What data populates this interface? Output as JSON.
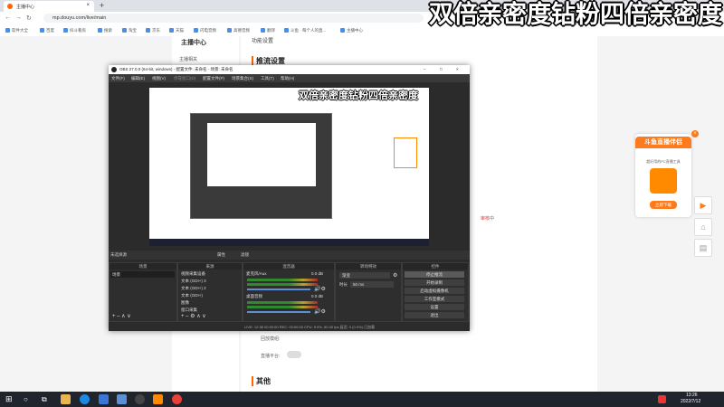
{
  "overlay_banner": "双倍亲密度钻粉四倍亲密度",
  "browser": {
    "tab_title": "主播中心",
    "new_tab": "+",
    "url": "mp.douyu.com/live/main",
    "bookmarks": [
      "软件大全",
      "百度",
      "抖斗看房",
      "搜索",
      "淘宝",
      "京东",
      "天猫",
      "闪电音频",
      "高德音频",
      "翻译",
      "斗鱼 · 每个人的直...",
      "主播中心"
    ]
  },
  "page": {
    "leftnav_title": "主播中心",
    "leftnav_item": "主播相关",
    "content_top": "功能设置",
    "section_push": "推流设置",
    "section_other": "其他",
    "label_record": "回放模组:",
    "label_fans": "直播平台:",
    "side_text": "审核中"
  },
  "promo": {
    "title": "斗鱼直播伴侣",
    "desc": "超好用的PC直播工具",
    "button": "立即下载",
    "close": "×"
  },
  "obs": {
    "title": "OBS 27.0.0 (64-bit, windows) - 配置文件: 未命名 - 场景: 未命名",
    "menu": [
      "文件(F)",
      "编辑(E)",
      "视图(V)",
      "停靠窗口(D)",
      "配置文件(P)",
      "场景集合(S)",
      "工具(T)",
      "帮助(H)"
    ],
    "preview_banner": "双倍亲密度钻粉四倍亲密度",
    "no_source": "未选择源",
    "props_button": "属性",
    "filters_button": "滤镜",
    "docks": {
      "scenes": {
        "title": "场景",
        "items": [
          "场景"
        ]
      },
      "sources": {
        "title": "来源",
        "items": [
          "视频采集设备",
          "文本 (GDI+) 3",
          "文本 (GDI+) 2",
          "文本 (GDI+)",
          "图像",
          "窗口采集"
        ]
      },
      "mixer": {
        "title": "混音器",
        "items": [
          "麦克风/Aux",
          "0.0 dB",
          "桌面音频",
          "0.0 dB"
        ]
      },
      "transitions": {
        "title": "转场特效",
        "items": [
          "渐变",
          "时长",
          "50 ms"
        ]
      },
      "controls": {
        "title": "控件",
        "items": [
          "停止推流",
          "开始录制",
          "启动虚拟摄像机",
          "工作室模式",
          "设置",
          "退出"
        ]
      }
    },
    "status": "LIVE: 12:38  00:00:00    REC: 00:00:00    CPU: 9.9%, 60.00 fps    延迟: 0 (0.0%) 已加载"
  },
  "taskbar": {
    "time": "13:26",
    "date": "2022/7/12"
  }
}
